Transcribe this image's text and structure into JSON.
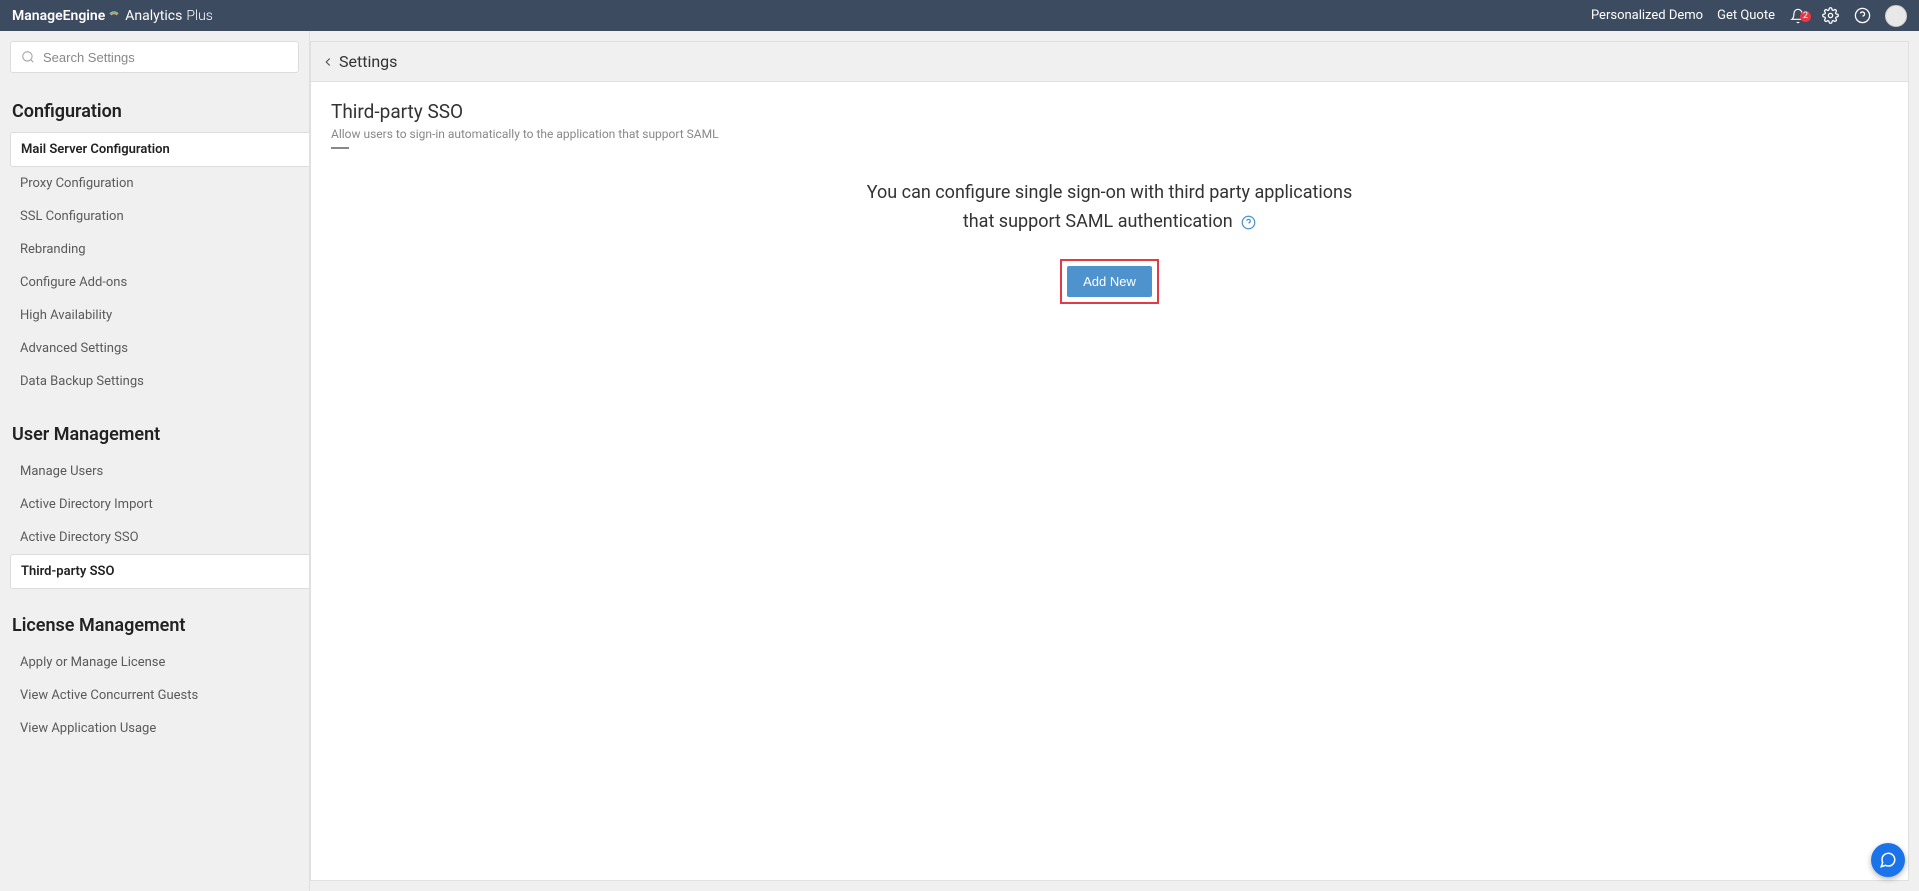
{
  "header": {
    "brand": "ManageEngine",
    "product": "Analytics",
    "suffix": "Plus",
    "links": {
      "demo": "Personalized Demo",
      "quote": "Get Quote"
    },
    "notification_count": "2"
  },
  "sidebar": {
    "search_placeholder": "Search Settings",
    "sections": {
      "configuration": {
        "title": "Configuration",
        "items": {
          "mail": "Mail Server Configuration",
          "proxy": "Proxy Configuration",
          "ssl": "SSL Configuration",
          "rebranding": "Rebranding",
          "addons": "Configure Add-ons",
          "ha": "High Availability",
          "advanced": "Advanced Settings",
          "backup": "Data Backup Settings"
        }
      },
      "user_management": {
        "title": "User Management",
        "items": {
          "manage_users": "Manage Users",
          "ad_import": "Active Directory Import",
          "ad_sso": "Active Directory SSO",
          "third_party_sso": "Third-party SSO"
        }
      },
      "license_management": {
        "title": "License Management",
        "items": {
          "apply": "Apply or Manage License",
          "concurrent": "View Active Concurrent Guests",
          "usage": "View Application Usage"
        }
      }
    }
  },
  "breadcrumb": {
    "title": "Settings"
  },
  "panel": {
    "title": "Third-party SSO",
    "subtitle": "Allow users to sign-in automatically to the application that support SAML",
    "empty_line1": "You can configure single sign-on with third party applications",
    "empty_line2": "that support SAML authentication",
    "add_button": "Add New"
  }
}
